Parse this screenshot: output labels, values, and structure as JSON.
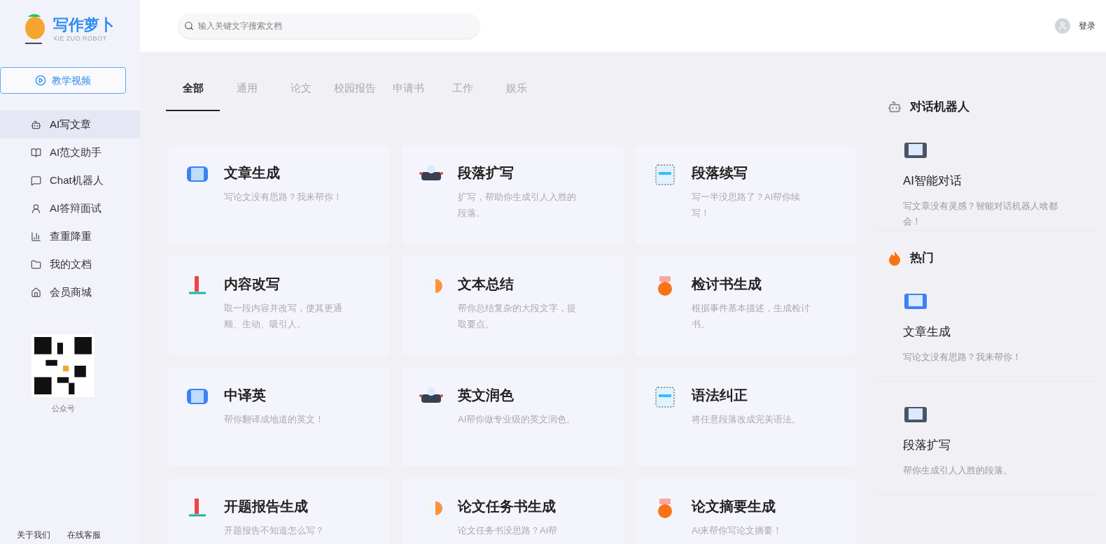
{
  "logo": {
    "name": "写作萝卜",
    "subtitle": "XIE ZUO ROBOT"
  },
  "search": {
    "placeholder": "输入关键文字搜索文档"
  },
  "user": {
    "login": "登录"
  },
  "sidebar": {
    "tutorial_button": "教学视频",
    "items": [
      {
        "label": "AI写文章",
        "selected": true
      },
      {
        "label": "AI范文助手",
        "selected": false
      },
      {
        "label": "Chat机器人",
        "selected": false
      },
      {
        "label": "AI答辩面试",
        "selected": false
      },
      {
        "label": "查重降重",
        "selected": false
      },
      {
        "label": "我的文档",
        "selected": false
      },
      {
        "label": "会员商城",
        "selected": false
      }
    ],
    "qr_caption": "公众号",
    "footer_links": [
      "关于我们",
      "在线客服"
    ]
  },
  "tabs": [
    {
      "label": "全部",
      "selected": true
    },
    {
      "label": "通用",
      "selected": false
    },
    {
      "label": "论文",
      "selected": false
    },
    {
      "label": "校园报告",
      "selected": false
    },
    {
      "label": "申请书",
      "selected": false
    },
    {
      "label": "工作",
      "selected": false
    },
    {
      "label": "娱乐",
      "selected": false
    }
  ],
  "cards": [
    {
      "title": "文章生成",
      "desc": "写论文没有思路？我来帮你！"
    },
    {
      "title": "段落扩写",
      "desc": "扩写，帮助你生成引人入胜的段落。"
    },
    {
      "title": "段落续写",
      "desc": "写一半没思路了？AI帮你续写！"
    },
    {
      "title": "内容改写",
      "desc": "取一段内容并改写，使其更通顺、生动、吸引人。"
    },
    {
      "title": "文本总结",
      "desc": "帮你总结复杂的大段文字，提取要点。"
    },
    {
      "title": "检讨书生成",
      "desc": "根据事件基本描述，生成检讨书。"
    },
    {
      "title": "中译英",
      "desc": "帮你翻译成地道的英文！"
    },
    {
      "title": "英文润色",
      "desc": "AI帮你做专业级的英文润色。"
    },
    {
      "title": "语法纠正",
      "desc": "将任意段落改成完美语法。"
    },
    {
      "title": "开题报告生成",
      "desc": "开题报告不知道怎么写？"
    },
    {
      "title": "论文任务书生成",
      "desc": "论文任务书没思路？AI帮"
    },
    {
      "title": "论文摘要生成",
      "desc": "AI来帮你写论文摘要！"
    }
  ],
  "right_panel": {
    "sections": [
      {
        "title": "对话机器人",
        "items": [
          {
            "title": "AI智能对话",
            "desc": "写文章没有灵感？智能对话机器人啥都会！"
          }
        ]
      },
      {
        "title": "热门",
        "items": [
          {
            "title": "文章生成",
            "desc": "写论文没有思路？我来帮你！"
          },
          {
            "title": "段落扩写",
            "desc": "帮你生成引人入胜的段落。"
          }
        ]
      }
    ]
  }
}
